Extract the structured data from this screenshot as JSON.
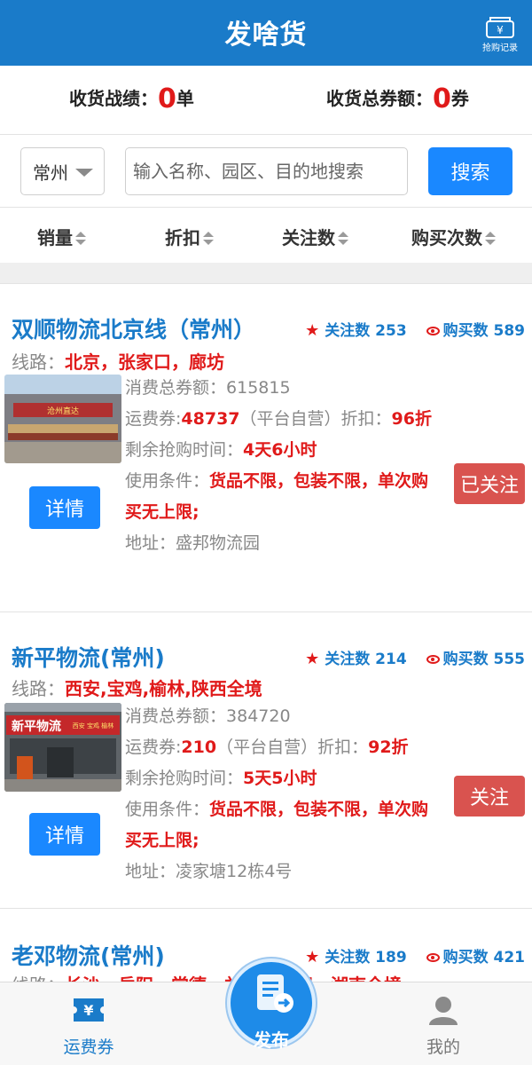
{
  "app": {
    "title": "发啥货",
    "record_label": "抢购记录"
  },
  "stats": {
    "record_label": "收货战绩：",
    "record_value": "0",
    "record_unit": "单",
    "total_label": "收货总券额：",
    "total_value": "0",
    "total_unit": "券"
  },
  "search": {
    "city": "常州",
    "placeholder": "输入名称、园区、目的地搜索",
    "button": "搜索"
  },
  "sort": [
    "销量",
    "折扣",
    "关注数",
    "购买次数"
  ],
  "cards": [
    {
      "name": "双顺物流北京线（常州）",
      "follow_label": "关注数",
      "follow_count": "253",
      "buy_label": "购买数",
      "buy_count": "589",
      "route_label": "线路：",
      "route": "北京，张家口，廊坊",
      "total_label": "消费总券额：",
      "total": "615815",
      "voucher_label": "运费券:",
      "voucher": "48737",
      "voucher_note": "（平台自营）折扣：",
      "discount": "96折",
      "time_label": "剩余抢购时间：",
      "time": "4天6小时",
      "cond_label": "使用条件：",
      "cond": "货品不限，包装不限，单次购买无上限;",
      "addr_label": "地址：",
      "addr": "盛邦物流园",
      "detail_button": "详情",
      "follow_button": "已关注"
    },
    {
      "name": "新平物流(常州)",
      "follow_label": "关注数",
      "follow_count": "214",
      "buy_label": "购买数",
      "buy_count": "555",
      "route_label": "线路：",
      "route": "西安,宝鸡,榆林,陕西全境",
      "total_label": "消费总券额：",
      "total": "384720",
      "voucher_label": "运费券:",
      "voucher": "210",
      "voucher_note": "（平台自营）折扣：",
      "discount": "92折",
      "time_label": "剩余抢购时间：",
      "time": "5天5小时",
      "cond_label": "使用条件：",
      "cond": "货品不限，包装不限，单次购买无上限;",
      "addr_label": "地址：",
      "addr": "凌家塘12栋4号",
      "detail_button": "详情",
      "follow_button": "关注"
    },
    {
      "name": "老邓物流(常州)",
      "follow_label": "关注数",
      "follow_count": "189",
      "buy_label": "购买数",
      "buy_count": "421",
      "route_label": "线路：",
      "route": "长沙，岳阳，常德，益阳，衡阳，湖南全境"
    }
  ],
  "tabs": {
    "voucher": "运费券",
    "publish": "发布",
    "mine": "我的"
  },
  "colors": {
    "primary": "#1a7bc9",
    "accent_red": "#e01a1a",
    "follow_red": "#d9534f",
    "button_blue": "#1a88ff"
  }
}
